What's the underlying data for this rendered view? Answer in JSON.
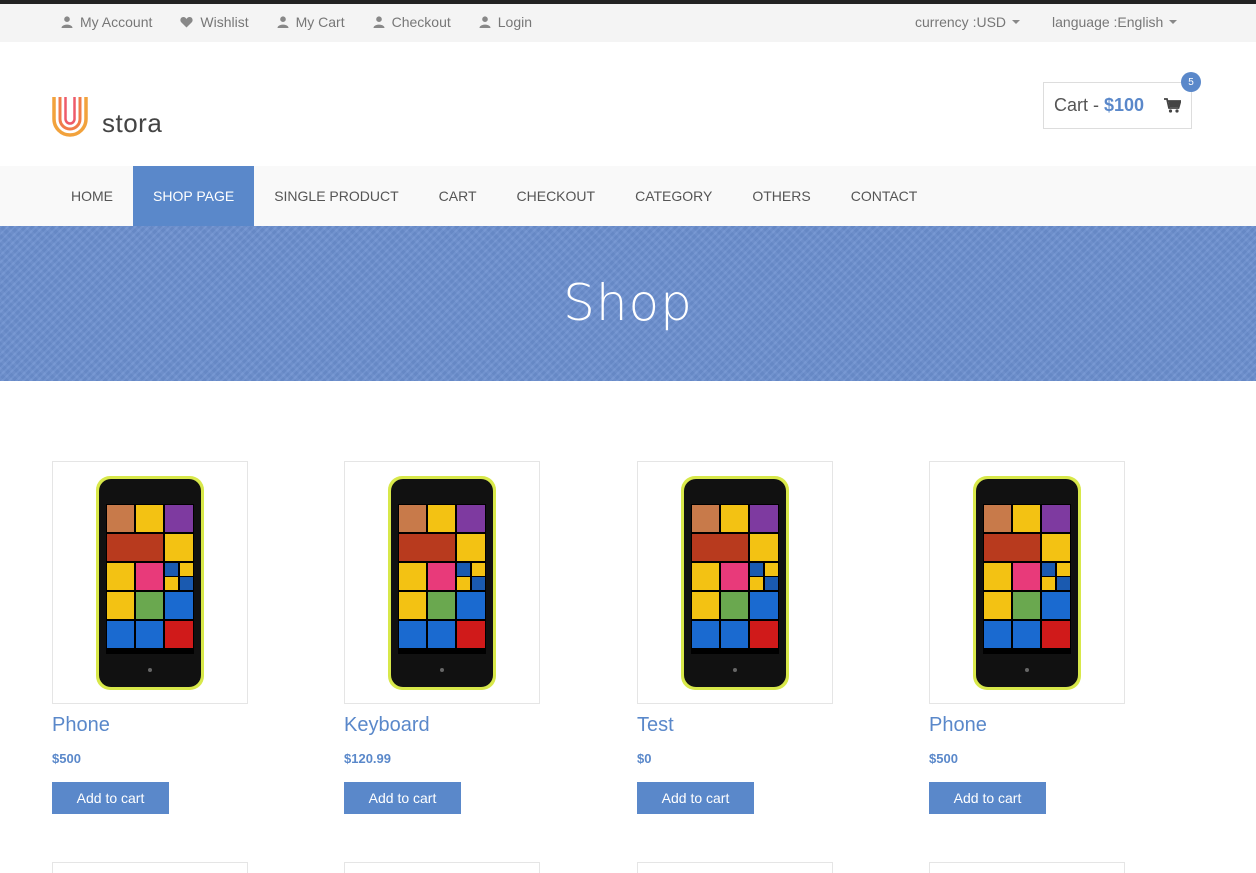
{
  "topbar": {
    "links": [
      {
        "label": "My Account",
        "icon": "user-icon"
      },
      {
        "label": "Wishlist",
        "icon": "heart-icon"
      },
      {
        "label": "My Cart",
        "icon": "user-icon"
      },
      {
        "label": "Checkout",
        "icon": "user-icon"
      },
      {
        "label": "Login",
        "icon": "user-icon"
      }
    ],
    "currency": "currency :USD",
    "language": "language :English"
  },
  "header": {
    "logo_text": "stora",
    "cart_label": "Cart -",
    "cart_amount": "$100",
    "cart_count": "5"
  },
  "nav": {
    "items": [
      "HOME",
      "SHOP PAGE",
      "SINGLE PRODUCT",
      "CART",
      "CHECKOUT",
      "CATEGORY",
      "OTHERS",
      "CONTACT"
    ],
    "active": "SHOP PAGE"
  },
  "banner": {
    "title": "Shop"
  },
  "products": [
    {
      "name": "Phone",
      "price": "$500",
      "button": "Add to cart"
    },
    {
      "name": "Keyboard",
      "price": "$120.99",
      "button": "Add to cart"
    },
    {
      "name": "Test",
      "price": "$0",
      "button": "Add to cart"
    },
    {
      "name": "Phone",
      "price": "$500",
      "button": "Add to cart"
    }
  ],
  "colors": {
    "accent": "#5a88ca",
    "banner": "#6b8fcf",
    "topbar": "#f4f4f4"
  }
}
